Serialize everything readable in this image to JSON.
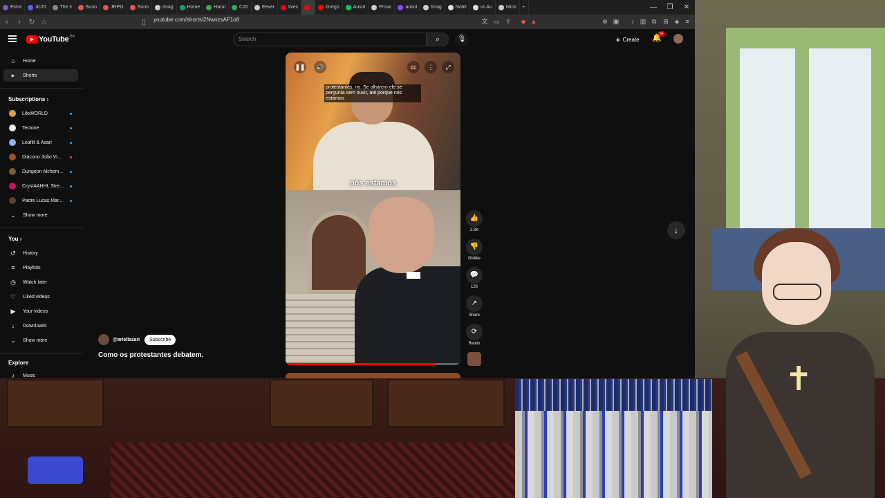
{
  "browser": {
    "tabs": [
      {
        "label": "Extra",
        "color": "#7e57c2"
      },
      {
        "label": "dc20",
        "color": "#5865f2"
      },
      {
        "label": "The li",
        "color": "#888888"
      },
      {
        "label": "Suno",
        "color": "#e2554a"
      },
      {
        "label": "JRPG",
        "color": "#e2554a"
      },
      {
        "label": "Suno",
        "color": "#e2554a"
      },
      {
        "label": "Imag",
        "color": "#cccccc"
      },
      {
        "label": "Home",
        "color": "#10a37f"
      },
      {
        "label": "Harul",
        "color": "#34a853"
      },
      {
        "label": "C20",
        "color": "#34a853"
      },
      {
        "label": "Eever",
        "color": "#cccccc"
      },
      {
        "label": "lives",
        "color": "#ff0000"
      },
      {
        "label": "",
        "color": "#ff0000"
      },
      {
        "label": "Grego",
        "color": "#ff0000"
      },
      {
        "label": "Ausol",
        "color": "#00c853"
      },
      {
        "label": "Provo",
        "color": "#cccccc"
      },
      {
        "label": "ausol",
        "color": "#9146ff"
      },
      {
        "label": "Imag",
        "color": "#cccccc"
      },
      {
        "label": "Notifi",
        "color": "#dddddd"
      },
      {
        "label": "vs Au",
        "color": "#dddddd"
      },
      {
        "label": "Músi",
        "color": "#cccccc"
      }
    ],
    "active_tab_index": 12,
    "url": "youtube.com/shorts/2NwnzsAF1o8"
  },
  "youtube": {
    "logo_text": "YouTube",
    "logo_sup": "BR",
    "search_placeholder": "Search",
    "create_label": "Create",
    "notification_badge": "9+"
  },
  "sidebar": {
    "main": [
      {
        "label": "Home",
        "icon": "⌂"
      },
      {
        "label": "Shorts",
        "icon": "▸"
      }
    ],
    "subscriptions_heading": "Subscriptions",
    "subscriptions": [
      {
        "label": "LiloWORLD",
        "color": "#d9a23b",
        "live": false
      },
      {
        "label": "Tectone",
        "color": "#eeeeee",
        "live": false
      },
      {
        "label": "Leaflit & Asari",
        "color": "#8ab4f8",
        "live": false
      },
      {
        "label": "Diácono João Vi...",
        "color": "#a0522d",
        "live": true
      },
      {
        "label": "Dungeon Alchem...",
        "color": "#7a5a3a",
        "live": false
      },
      {
        "label": "CrystAAHHL Stre...",
        "color": "#c2185b",
        "live": false
      },
      {
        "label": "Padre Lucas Mar...",
        "color": "#5d4037",
        "live": false
      }
    ],
    "show_more_1": "Show more",
    "you_heading": "You",
    "you_items": [
      {
        "label": "History",
        "icon": "↺"
      },
      {
        "label": "Playlists",
        "icon": "≡"
      },
      {
        "label": "Watch later",
        "icon": "◷"
      },
      {
        "label": "Liked videos",
        "icon": "♡"
      },
      {
        "label": "Your videos",
        "icon": "▶"
      },
      {
        "label": "Downloads",
        "icon": "↓"
      }
    ],
    "show_more_2": "Show more",
    "explore_heading": "Explore",
    "explore_items": [
      {
        "label": "Music",
        "icon": "♪"
      }
    ]
  },
  "short": {
    "caption_top": "protestantes, no. Se olharem ele se pergunta sem ouvir, até porque nós estamos",
    "caption_main": "nós estamos",
    "channel": "@ariellazari",
    "subscribe_label": "Subscribe",
    "title": "Como os protestantes debatem.",
    "progress": 0.86
  },
  "actions": [
    {
      "icon": "👍",
      "label": "2.3K"
    },
    {
      "icon": "👎",
      "label": "Dislike"
    },
    {
      "icon": "💬",
      "label": "126"
    },
    {
      "icon": "↗",
      "label": "Share"
    },
    {
      "icon": "⟳",
      "label": "Remix"
    }
  ]
}
